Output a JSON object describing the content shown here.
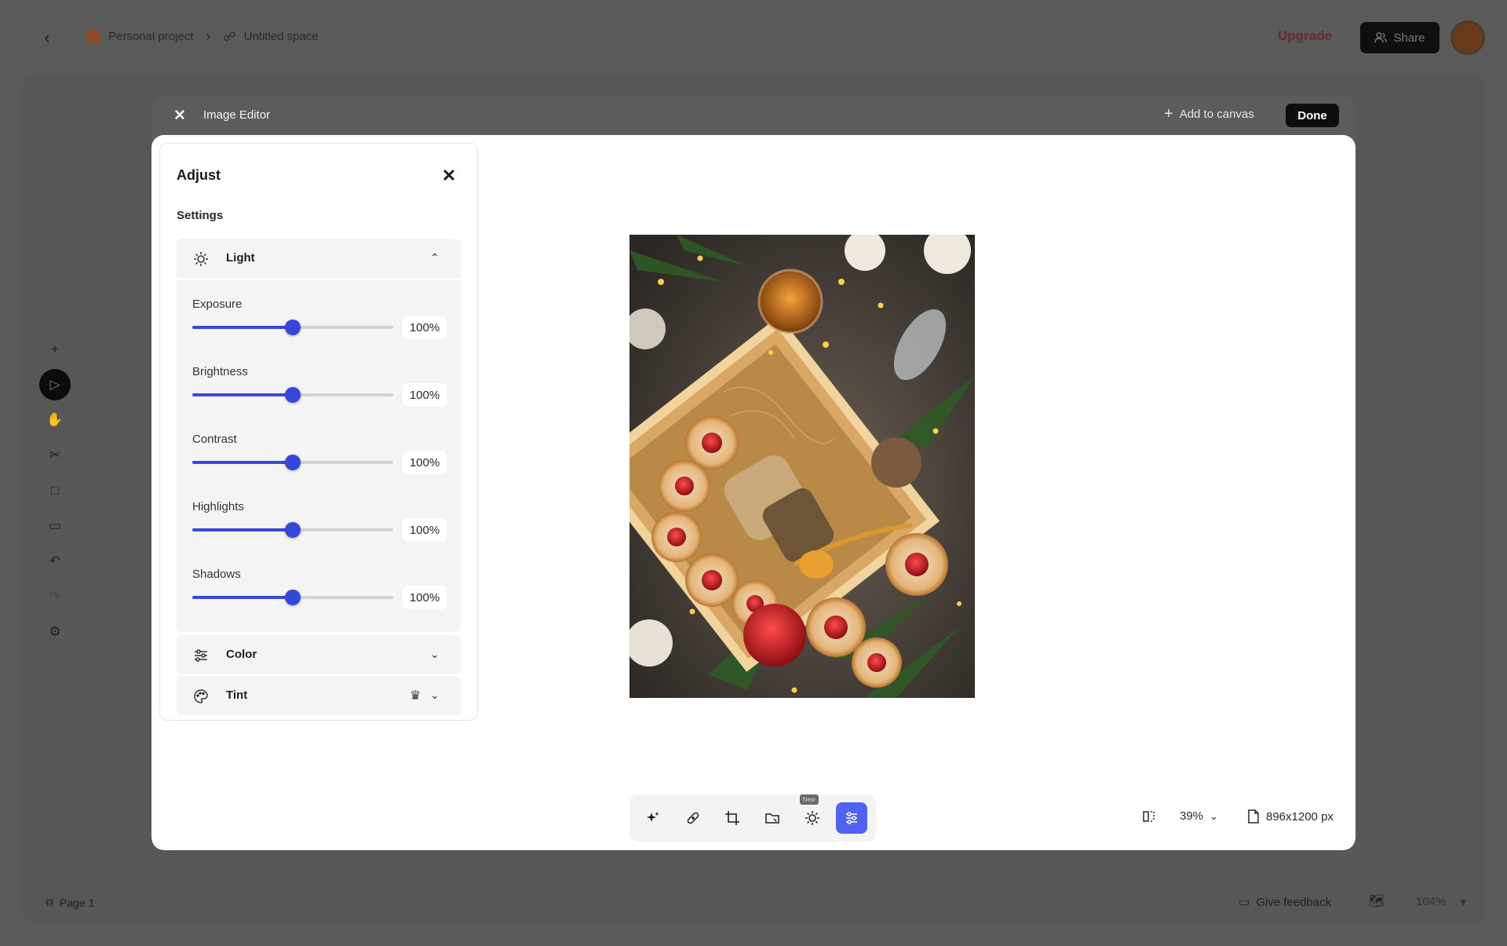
{
  "app": {
    "breadcrumb": {
      "project": "Personal project",
      "space": "Untitled space"
    },
    "upgrade_label": "Upgrade",
    "share_label": "Share",
    "page_label": "Page 1",
    "feedback_label": "Give feedback",
    "canvas_zoom": "104%"
  },
  "modal": {
    "title": "Image Editor",
    "add_to_canvas": "Add to canvas",
    "done_label": "Done"
  },
  "panel": {
    "title": "Adjust",
    "settings_label": "Settings",
    "sections": {
      "light": {
        "label": "Light"
      },
      "color": {
        "label": "Color"
      },
      "tint": {
        "label": "Tint"
      }
    },
    "sliders": [
      {
        "label": "Exposure",
        "value": "100%",
        "level": 0.5
      },
      {
        "label": "Brightness",
        "value": "100%",
        "level": 0.5
      },
      {
        "label": "Contrast",
        "value": "100%",
        "level": 0.5
      },
      {
        "label": "Highlights",
        "value": "100%",
        "level": 0.5
      },
      {
        "label": "Shadows",
        "value": "100%",
        "level": 0.5
      }
    ]
  },
  "toolbar": {
    "new_badge": "New"
  },
  "status": {
    "zoom": "39%",
    "dimensions": "896x1200 px"
  },
  "colors": {
    "accent": "#3a4ad6",
    "active_tool": "#4f62f0",
    "upgrade": "#6b2a34"
  }
}
